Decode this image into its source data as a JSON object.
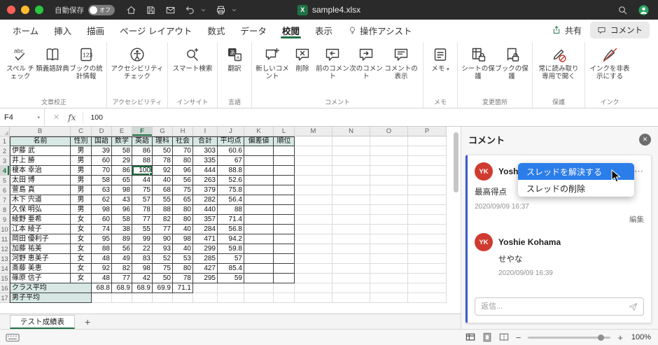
{
  "title_bar": {
    "autosave_label": "自動保存",
    "autosave_state": "オフ",
    "document_title": "sample4.xlsx"
  },
  "ribbon": {
    "tabs": [
      "ホーム",
      "挿入",
      "描画",
      "ページ レイアウト",
      "数式",
      "データ",
      "校閲",
      "表示"
    ],
    "active_tab": "校閲",
    "assistant_tab": "操作アシスト",
    "share_label": "共有",
    "comments_label": "コメント",
    "groups": [
      {
        "label": "文章校正",
        "buttons": [
          {
            "label": "スペル チェック"
          },
          {
            "label": "類義語辞典"
          },
          {
            "label": "ブックの統計情報"
          }
        ]
      },
      {
        "label": "アクセシビリティ",
        "buttons": [
          {
            "label": "アクセシビリティ チェック"
          }
        ]
      },
      {
        "label": "インサイト",
        "buttons": [
          {
            "label": "スマート検索"
          }
        ]
      },
      {
        "label": "言語",
        "buttons": [
          {
            "label": "翻訳"
          }
        ]
      },
      {
        "label": "コメント",
        "buttons": [
          {
            "label": "新しいコメント"
          },
          {
            "label": "削除"
          },
          {
            "label": "前のコメント"
          },
          {
            "label": "次のコメント"
          },
          {
            "label": "コメントの表示"
          }
        ]
      },
      {
        "label": "メモ",
        "buttons": [
          {
            "label": "メモ"
          }
        ]
      },
      {
        "label": "変更箇所",
        "buttons": [
          {
            "label": "シートの保護"
          },
          {
            "label": "ブックの保護"
          }
        ]
      },
      {
        "label": "保護",
        "buttons": [
          {
            "label": "常に読み取り専用で開く"
          }
        ]
      },
      {
        "label": "インク",
        "buttons": [
          {
            "label": "インクを非表示にする"
          }
        ]
      }
    ]
  },
  "formula_bar": {
    "name_box": "F4",
    "fx_label": "fx",
    "value": "100"
  },
  "grid": {
    "columns": [
      "B",
      "C",
      "D",
      "E",
      "F",
      "G",
      "H",
      "I",
      "J",
      "K",
      "L",
      "M",
      "N",
      "O",
      "P"
    ],
    "header_row": [
      "名前",
      "性別",
      "国語",
      "数学",
      "英語",
      "理科",
      "社会",
      "合計",
      "平均点",
      "偏差値",
      "順位"
    ],
    "rows": [
      [
        "伊藤 武",
        "男",
        39,
        58,
        86,
        50,
        70,
        303,
        60.6
      ],
      [
        "井上 勝",
        "男",
        60,
        29,
        88,
        78,
        80,
        335,
        67
      ],
      [
        "榎本 幸治",
        "男",
        70,
        86,
        100,
        92,
        96,
        444,
        88.8
      ],
      [
        "太田 博",
        "男",
        58,
        65,
        44,
        40,
        56,
        263,
        52.6
      ],
      [
        "萱島 真",
        "男",
        63,
        98,
        75,
        68,
        75,
        379,
        75.8
      ],
      [
        "木下 宍道",
        "男",
        62,
        43,
        57,
        55,
        65,
        282,
        56.4
      ],
      [
        "久保 明弘",
        "男",
        98,
        96,
        78,
        88,
        80,
        440,
        88
      ],
      [
        "綾野 亜希",
        "女",
        60,
        58,
        77,
        82,
        80,
        357,
        71.4
      ],
      [
        "江本 綾子",
        "女",
        74,
        38,
        55,
        77,
        40,
        284,
        56.8
      ],
      [
        "岡田 優利子",
        "女",
        95,
        89,
        99,
        90,
        98,
        471,
        94.2
      ],
      [
        "加藤 祐美",
        "女",
        88,
        56,
        22,
        93,
        40,
        299,
        59.8
      ],
      [
        "河野 恵美子",
        "女",
        48,
        49,
        83,
        52,
        53,
        285,
        57
      ],
      [
        "斎藤 美恵",
        "女",
        92,
        82,
        98,
        75,
        80,
        427,
        85.4
      ],
      [
        "篠原 信子",
        "女",
        48,
        77,
        42,
        50,
        78,
        295,
        59
      ]
    ],
    "summary_rows": [
      {
        "label": "クラス平均",
        "values": [
          68.8,
          68.9,
          68.9,
          69.9,
          71.1
        ]
      },
      {
        "label": "男子平均",
        "values": []
      }
    ],
    "selected_column": "F",
    "selected_row": 4,
    "active_cell": "F4",
    "active_cell_value": 100
  },
  "sheet": {
    "active_tab": "テスト成績表"
  },
  "status_bar": {
    "zoom": "100%"
  },
  "comments_pane": {
    "title": "コメント",
    "thread": {
      "messages": [
        {
          "initials": "YK",
          "author": "Yoshie Kohama",
          "text": "最高得点",
          "time": "2020/09/09 16:37",
          "edit": "編集"
        },
        {
          "initials": "YK",
          "author": "Yoshie Kohama",
          "text": "せやな",
          "time": "2020/09/09 16:39"
        }
      ],
      "reply_placeholder": "返信..."
    },
    "menu": {
      "items": [
        {
          "label": "スレッドを解決する"
        },
        {
          "label": "スレッドの削除"
        }
      ],
      "highlighted_index": 0
    }
  },
  "icons": {
    "close": "✕",
    "cancel": "✕",
    "more": "⋯",
    "dropdown": "▾",
    "add_sheet": "+",
    "minus": "−",
    "plus": "+"
  },
  "colors": {
    "excel_green": "#1f7244",
    "menu_highlight": "#2b7de9",
    "avatar_red": "#cf3b30",
    "thread_accent": "#3d5cc8",
    "table_header_fill": "#d7e8e4"
  }
}
